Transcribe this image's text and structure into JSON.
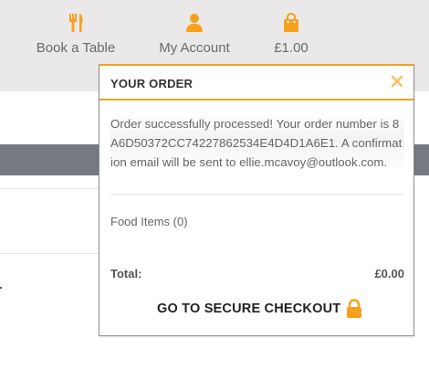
{
  "nav": {
    "book_table": {
      "label": "Book a Table",
      "icon": "utensils-icon"
    },
    "account": {
      "label": "My Account",
      "icon": "user-icon"
    },
    "basket": {
      "label": "£1.00",
      "icon": "shopping-bag-icon"
    }
  },
  "order_panel": {
    "title": "YOUR ORDER",
    "close_icon": "close-icon",
    "message": "Order successfully processed! Your order number is 8A6D50372CC74227862534E4D4D1A6E1. A confirmation email will be sent to ellie.mcavoy@outlook.com.",
    "food_items_label": "Food Items (0)",
    "total_label": "Total:",
    "total_value": "£0.00",
    "checkout_label": "GO TO SECURE CHECKOUT",
    "checkout_icon": "lock-icon"
  },
  "colors": {
    "accent": "#f7a01e",
    "header_bg": "#ebe8e9",
    "strip": "#747a7f"
  }
}
